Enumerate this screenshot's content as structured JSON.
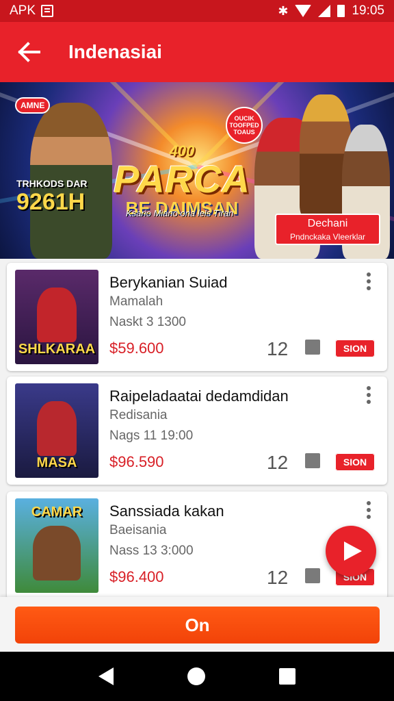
{
  "status_bar": {
    "app_label": "APK",
    "time": "19:05"
  },
  "app_bar": {
    "title": "Indenasiai"
  },
  "banner": {
    "badge": "AMNE",
    "left_text_1": "TRHKODS DAR",
    "left_text_2": "9261H",
    "number": "400",
    "title": "PARCA",
    "subtitle": "BE DAIMSAN",
    "tagline": "Ksario Miano ona lels Tiran",
    "bubble": "OUCIK TOOFPED TOAUS",
    "box_title": "Dechani",
    "box_sub": "Pndnckaka Vleerklar"
  },
  "items": [
    {
      "name": "Berykanian Suiad",
      "sub": "Mamalah",
      "meta": "Naskt 3 1300",
      "price": "$59.600",
      "count": "12",
      "button": "SION",
      "thumb_title": "SHLKARAA",
      "thumb_bg": "#5a2a6a",
      "fig": "#c2252b"
    },
    {
      "name": "Raipeladaatai dedamdidan",
      "sub": "Redisania",
      "meta": "Nags 11 19:00",
      "price": "$96.590",
      "count": "12",
      "button": "SION",
      "thumb_title": "MASA",
      "thumb_bg": "#3a3a8a",
      "fig": "#b8282e"
    },
    {
      "name": "Sanssiada kakan",
      "sub": "Baeisania",
      "meta": "Nass 13 3:000",
      "price": "$96.400",
      "count": "12",
      "button": "SION",
      "thumb_title": "CAMAR",
      "thumb_bg": "#3f8a3a",
      "fig": "#7a4a2a"
    }
  ],
  "bottom_button": {
    "label": "On"
  },
  "colors": {
    "primary": "#e8222a",
    "status": "#c8161d",
    "cta": "#f24309",
    "price": "#d81f26"
  }
}
